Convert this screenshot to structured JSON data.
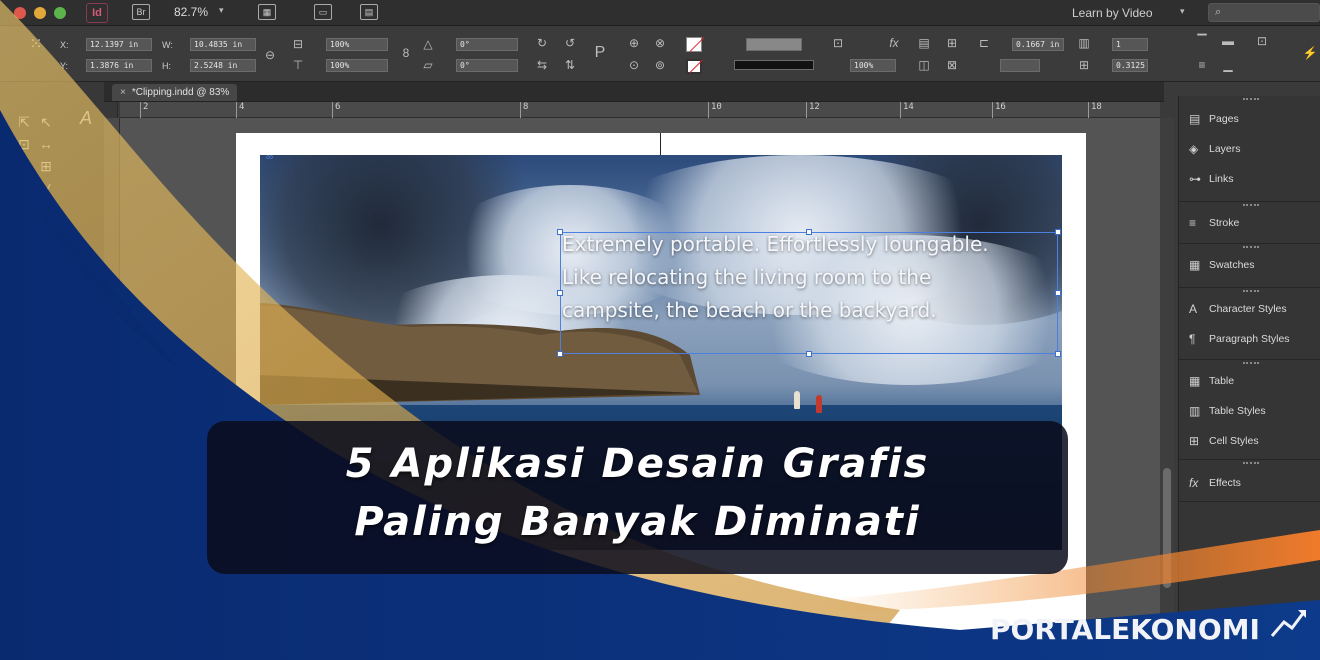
{
  "app": {
    "badge": "Id",
    "zoom": "82.7%",
    "workspace_menu": "Learn by Video",
    "search_placeholder": ""
  },
  "control_panel": {
    "x_label": "X:",
    "x_value": "12.1397 in",
    "y_label": "Y:",
    "y_value": "1.3876 in",
    "w_label": "W:",
    "w_value": "10.4835 in",
    "h_label": "H:",
    "h_value": "2.5248 in",
    "scale_x": "100%",
    "scale_y": "100%",
    "rotate": "0°",
    "shear": "0°",
    "stroke_weight": "100%",
    "fitting_offset": "0.1667 in",
    "columns": "1",
    "gutter": "0.3125"
  },
  "document": {
    "tab_label": "*Clipping.indd @ 83%",
    "ruler_ticks": [
      "2",
      "4",
      "6",
      "8",
      "10",
      "12",
      "14",
      "16",
      "18"
    ],
    "overlay_lines": [
      "Extremely portable. Effortlessly loungable.",
      "Like relocating the living room to the",
      "campsite, the beach or the backyard."
    ]
  },
  "panels": [
    {
      "label": "Pages",
      "icon": "pages-icon"
    },
    {
      "label": "Layers",
      "icon": "layers-icon"
    },
    {
      "label": "Links",
      "icon": "links-icon"
    },
    {
      "label": "Stroke",
      "icon": "stroke-icon"
    },
    {
      "label": "Swatches",
      "icon": "swatches-icon"
    },
    {
      "label": "Character Styles",
      "icon": "character-styles-icon"
    },
    {
      "label": "Paragraph Styles",
      "icon": "paragraph-styles-icon"
    },
    {
      "label": "Table",
      "icon": "table-icon"
    },
    {
      "label": "Table Styles",
      "icon": "table-styles-icon"
    },
    {
      "label": "Cell Styles",
      "icon": "cell-styles-icon"
    },
    {
      "label": "Effects",
      "icon": "effects-icon"
    }
  ],
  "headline": {
    "line1": "5 Aplikasi Desain Grafis",
    "line2": "Paling Banyak Diminati"
  },
  "brand": {
    "name": "PORTALEKONOMI"
  },
  "colors": {
    "navy": "#0b2a6b",
    "gold": "#d9a64a",
    "orange": "#e8702a",
    "frame_blue": "#4b7fe0"
  }
}
